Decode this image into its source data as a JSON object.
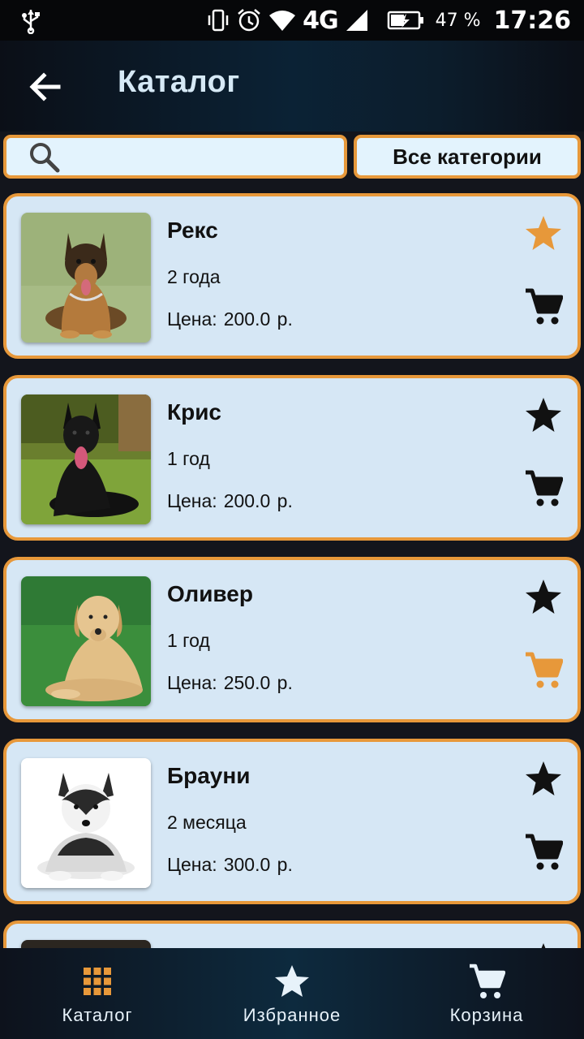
{
  "status_bar": {
    "network": "4G",
    "battery_percent": "47 %",
    "time": "17:26"
  },
  "toolbar": {
    "title": "Каталог"
  },
  "search": {
    "placeholder": "",
    "value": ""
  },
  "category_filter": {
    "label": "Все категории"
  },
  "colors": {
    "accent": "#e7983a",
    "card_background": "#d6e7f5",
    "title_text": "#d6e9f6"
  },
  "products": [
    {
      "name": "Рекс",
      "age": "2 года",
      "price_label": "Цена:",
      "price": "200.0",
      "currency": "р.",
      "favorite": true,
      "in_cart": false
    },
    {
      "name": "Крис",
      "age": "1 год",
      "price_label": "Цена:",
      "price": "200.0",
      "currency": "р.",
      "favorite": false,
      "in_cart": false
    },
    {
      "name": "Оливер",
      "age": "1 год",
      "price_label": "Цена:",
      "price": "250.0",
      "currency": "р.",
      "favorite": false,
      "in_cart": true
    },
    {
      "name": "Брауни",
      "age": "2 месяца",
      "price_label": "Цена:",
      "price": "300.0",
      "currency": "р.",
      "favorite": false,
      "in_cart": false
    }
  ],
  "bottom_nav": {
    "items": [
      {
        "label": "Каталог",
        "icon": "grid-icon",
        "active": true
      },
      {
        "label": "Избранное",
        "icon": "star-icon",
        "active": false
      },
      {
        "label": "Корзина",
        "icon": "cart-icon",
        "active": false
      }
    ]
  }
}
